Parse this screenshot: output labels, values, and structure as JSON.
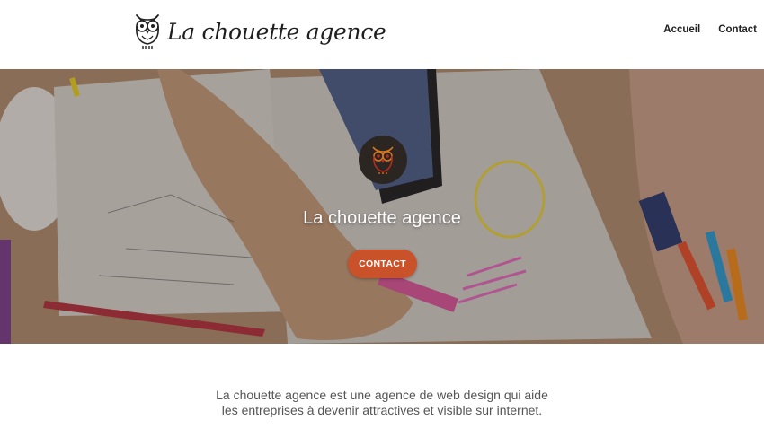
{
  "header": {
    "brand_name": "La chouette agence",
    "nav": [
      {
        "label": "Accueil"
      },
      {
        "label": "Contact"
      }
    ]
  },
  "hero": {
    "title": "La chouette agence",
    "cta_label": "CONTACT"
  },
  "intro": {
    "line1": "La chouette agence est une agence de web design qui aide",
    "line2": "les entreprises à devenir attractives et visible sur internet."
  },
  "icons": {
    "logo": "owl-logo-icon",
    "hero_badge": "owl-icon"
  },
  "colors": {
    "accent": "#c9522a",
    "badge_bg": "#2c2622",
    "owl_orange": "#d9771e",
    "owl_red": "#b52b1e"
  }
}
